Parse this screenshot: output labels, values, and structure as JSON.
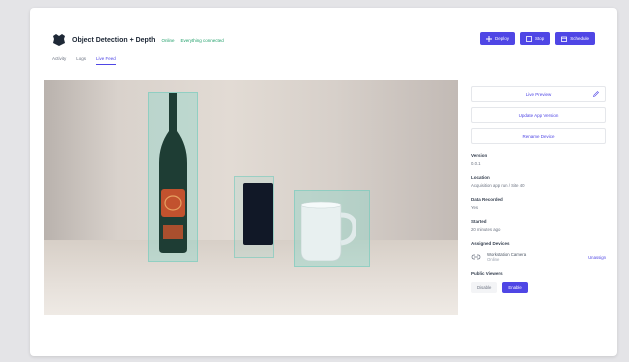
{
  "header": {
    "title": "Object Detection + Depth",
    "status": "Online",
    "status_extra": "Everything connected"
  },
  "actions": {
    "deploy_label": "Deploy",
    "stop_label": "Stop",
    "schedule_label": "Schedule"
  },
  "tabs": [
    {
      "label": "Activity"
    },
    {
      "label": "Logs"
    },
    {
      "label": "Live Feed"
    }
  ],
  "panel": {
    "links": [
      {
        "label": "Live Preview"
      },
      {
        "label": "Update App Version"
      },
      {
        "label": "Rename Device"
      }
    ],
    "fields": [
      {
        "label": "Version",
        "value": "0.0.1"
      },
      {
        "label": "Location",
        "value": "Acquisition app run / Site 40"
      },
      {
        "label": "Data Recorded",
        "value": "Yes"
      },
      {
        "label": "Started",
        "value": "20 minutes ago"
      }
    ],
    "device": {
      "label": "Assigned Devices",
      "name": "Workstation Camera",
      "sub": "Online",
      "unlink": "Unassign"
    },
    "visibility": {
      "label": "Public Viewers",
      "off": "Disable",
      "on": "Enable"
    }
  },
  "colors": {
    "accent": "#4f46e5",
    "online": "#22a06b"
  }
}
